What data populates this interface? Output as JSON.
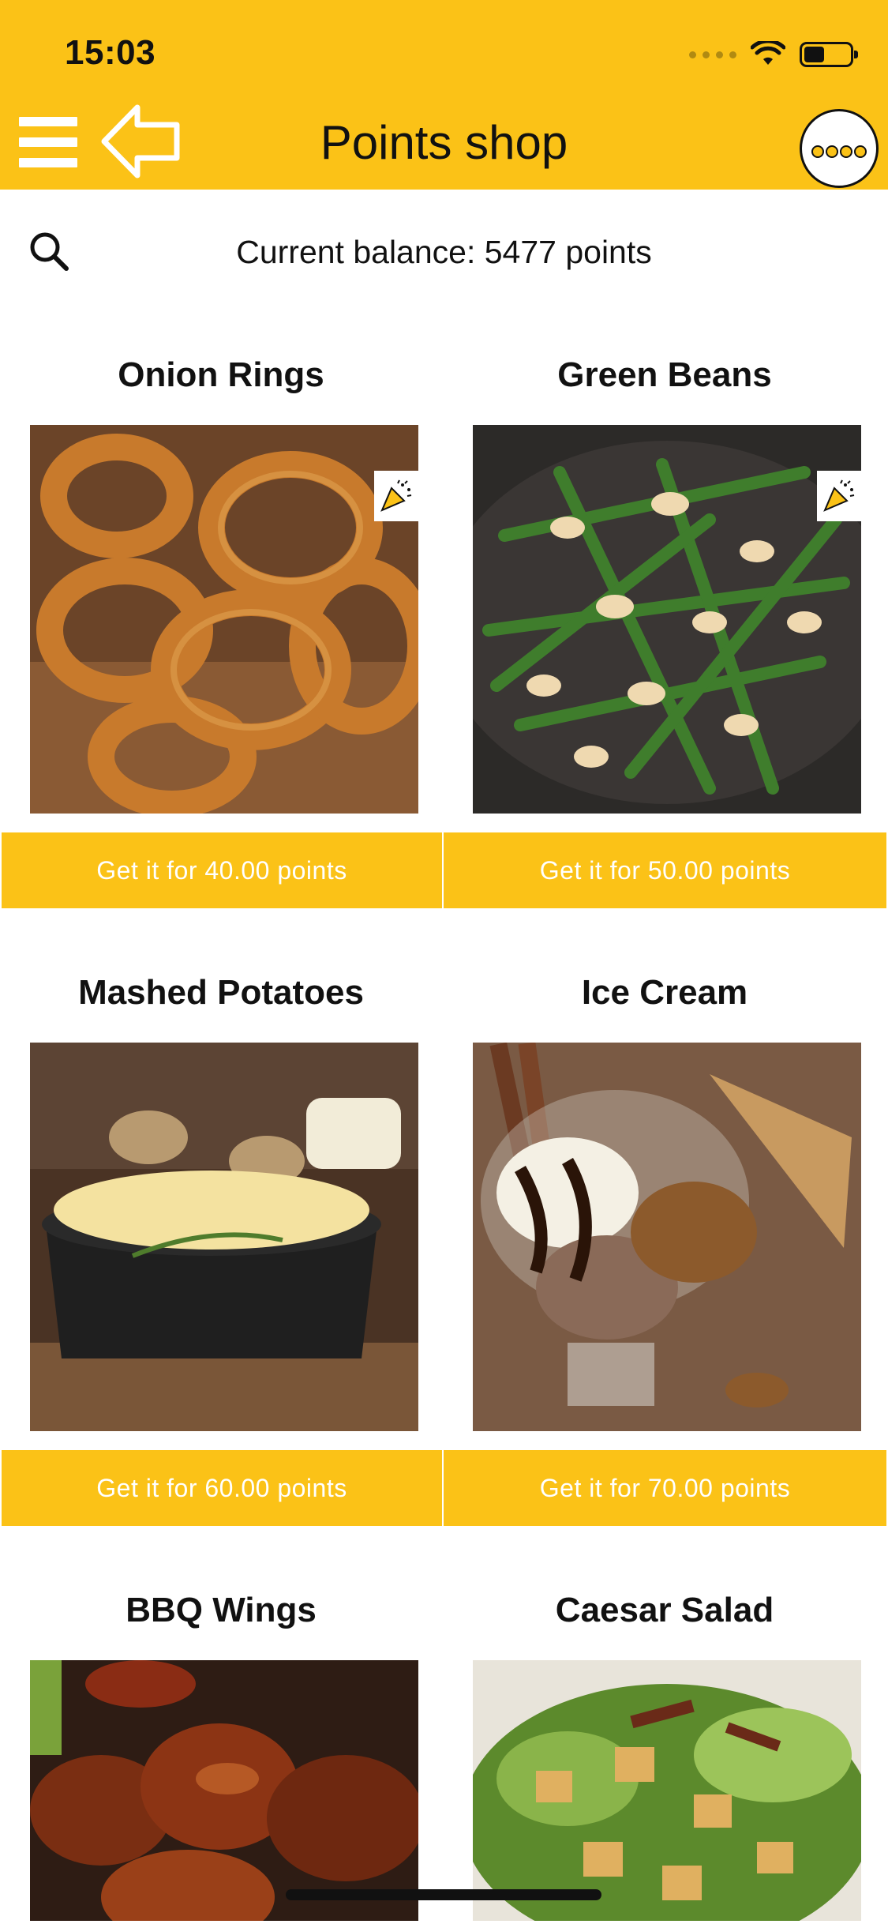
{
  "status": {
    "time": "15:03",
    "battery_level": 0.45
  },
  "header": {
    "title": "Points shop"
  },
  "balance": {
    "text": "Current balance: 5477 points"
  },
  "items": [
    {
      "name": "Onion Rings",
      "button": "Get it for 40.00 points",
      "promo": true
    },
    {
      "name": "Green Beans",
      "button": "Get it for 50.00 points",
      "promo": true
    },
    {
      "name": "Mashed Potatoes",
      "button": "Get it for 60.00 points",
      "promo": false
    },
    {
      "name": "Ice Cream",
      "button": "Get it for 70.00 points",
      "promo": false
    },
    {
      "name": "BBQ Wings",
      "button": "",
      "promo": false
    },
    {
      "name": "Caesar Salad",
      "button": "",
      "promo": false
    }
  ],
  "colors": {
    "accent": "#FBC217",
    "text": "#111111",
    "button_text": "#ffffff"
  },
  "icons": {
    "menu": "hamburger-icon",
    "back": "back-arrow-icon",
    "badge": "loyalty-badge-icon",
    "search": "search-icon",
    "promo": "party-popper-icon"
  }
}
